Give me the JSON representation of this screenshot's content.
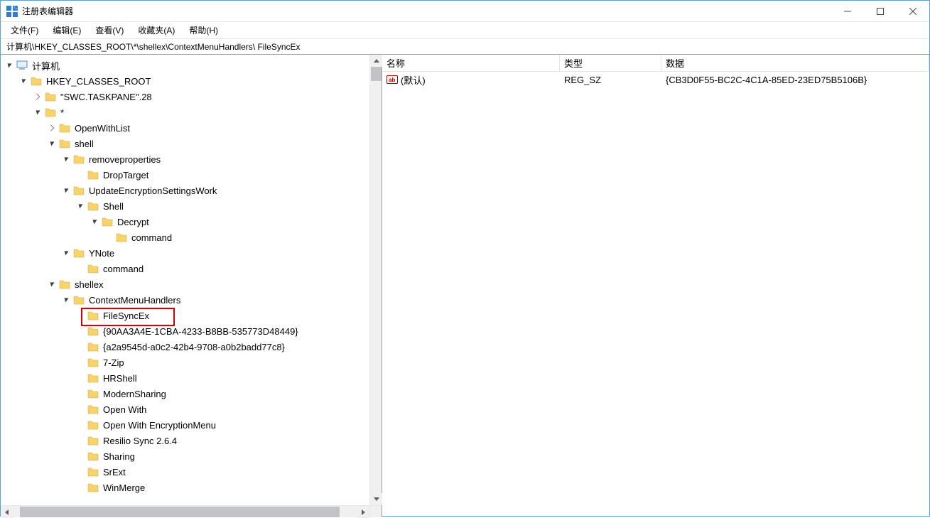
{
  "window": {
    "title": "注册表编辑器"
  },
  "menu": {
    "file": "文件(F)",
    "edit": "编辑(E)",
    "view": "查看(V)",
    "favorites": "收藏夹(A)",
    "help": "帮助(H)"
  },
  "address": "计算机\\HKEY_CLASSES_ROOT\\*\\shellex\\ContextMenuHandlers\\ FileSyncEx",
  "tree": {
    "root": "计算机",
    "hkcr": "HKEY_CLASSES_ROOT",
    "swc": "\"SWC.TASKPANE\".28",
    "star": "*",
    "openwithlist": "OpenWithList",
    "shell": "shell",
    "removeproperties": "removeproperties",
    "droptarget": "DropTarget",
    "updateenc": "UpdateEncryptionSettingsWork",
    "shell2": "Shell",
    "decrypt": "Decrypt",
    "command1": "command",
    "ynote": "YNote",
    "command2": "command",
    "shellex": "shellex",
    "cmh": "ContextMenuHandlers",
    "filesyncex": " FileSyncEx",
    "guid1": "{90AA3A4E-1CBA-4233-B8BB-535773D48449}",
    "guid2": "{a2a9545d-a0c2-42b4-9708-a0b2badd77c8}",
    "sevenzip": "7-Zip",
    "hrshell": "HRShell",
    "modernsharing": "ModernSharing",
    "openwith": "Open With",
    "openwithenc": "Open With EncryptionMenu",
    "resilio": "Resilio Sync 2.6.4",
    "sharing": "Sharing",
    "srext": "SrExt",
    "winmerge": "WinMerge"
  },
  "list": {
    "header": {
      "name": "名称",
      "type": "类型",
      "data": "数据"
    },
    "row": {
      "name": "(默认)",
      "type": "REG_SZ",
      "data": "{CB3D0F55-BC2C-4C1A-85ED-23ED75B5106B}"
    }
  }
}
